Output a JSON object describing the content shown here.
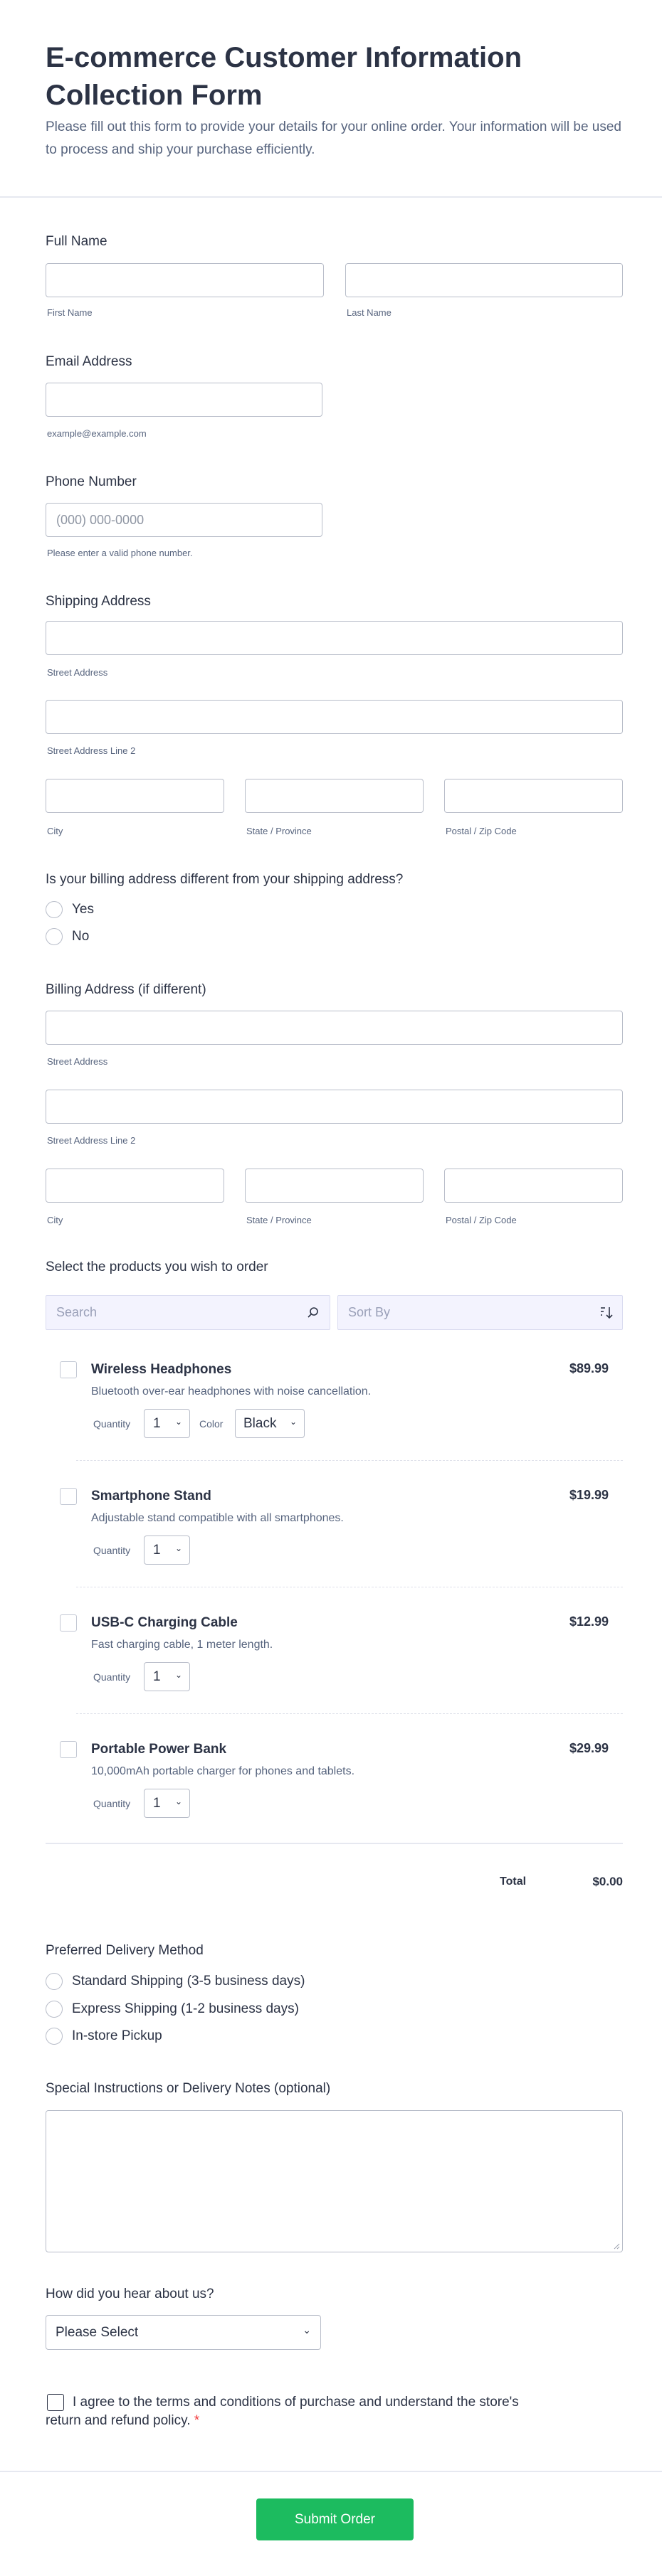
{
  "header": {
    "title": "E-commerce Customer Information Collection Form",
    "subtitle": "Please fill out this form to provide your details for your online order. Your information will be used to process and ship your purchase efficiently."
  },
  "full_name": {
    "label": "Full Name",
    "first": "First Name",
    "last": "Last Name"
  },
  "email": {
    "label": "Email Address",
    "sublabel": "example@example.com"
  },
  "phone": {
    "label": "Phone Number",
    "placeholder": "(000) 000-0000",
    "sublabel": "Please enter a valid phone number."
  },
  "shipping": {
    "label": "Shipping Address",
    "street": "Street Address",
    "street2": "Street Address Line 2",
    "city": "City",
    "state": "State / Province",
    "zip": "Postal / Zip Code"
  },
  "billing_question": {
    "label": "Is your billing address different from your shipping address?",
    "options": [
      "Yes",
      "No"
    ]
  },
  "billing": {
    "label": "Billing Address (if different)",
    "street": "Street Address",
    "street2": "Street Address Line 2",
    "city": "City",
    "state": "State / Province",
    "zip": "Postal / Zip Code"
  },
  "products": {
    "label": "Select the products you wish to order",
    "search_placeholder": "Search",
    "sort_placeholder": "Sort By",
    "quantity_label": "Quantity",
    "color_label": "Color",
    "items": [
      {
        "name": "Wireless Headphones",
        "price": "$89.99",
        "desc": "Bluetooth over-ear headphones with noise cancellation.",
        "qty": "1",
        "color": "Black"
      },
      {
        "name": "Smartphone Stand",
        "price": "$19.99",
        "desc": "Adjustable stand compatible with all smartphones.",
        "qty": "1"
      },
      {
        "name": "USB-C Charging Cable",
        "price": "$12.99",
        "desc": "Fast charging cable, 1 meter length.",
        "qty": "1"
      },
      {
        "name": "Portable Power Bank",
        "price": "$29.99",
        "desc": "10,000mAh portable charger for phones and tablets.",
        "qty": "1"
      }
    ],
    "total_label": "Total",
    "total_value": "$0.00"
  },
  "delivery": {
    "label": "Preferred Delivery Method",
    "options": [
      "Standard Shipping (3-5 business days)",
      "Express Shipping (1-2 business days)",
      "In-store Pickup"
    ]
  },
  "notes": {
    "label": "Special Instructions or Delivery Notes (optional)"
  },
  "referral": {
    "label": "How did you hear about us?",
    "value": "Please Select"
  },
  "terms": {
    "text": "I agree to the terms and conditions of purchase and understand the store's return and refund policy.",
    "required_mark": "*"
  },
  "submit": {
    "label": "Submit Order"
  },
  "colors": {
    "accent": "#1cbb5f",
    "required": "#f23a3c"
  }
}
